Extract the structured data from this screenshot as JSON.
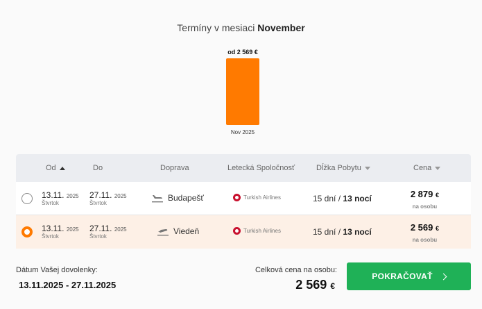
{
  "header": {
    "title_prefix": "Termíny v mesiaci",
    "title_month": "November"
  },
  "chart_data": {
    "type": "bar",
    "categories": [
      "Nov 2025"
    ],
    "values": [
      2569
    ],
    "value_labels": [
      "od 2 569 €"
    ],
    "bar_color": "#ff7a00",
    "title": "",
    "xlabel": "",
    "ylabel": ""
  },
  "table": {
    "columns": {
      "from": "Od",
      "to": "Do",
      "transport": "Doprava",
      "airline": "Letecká Spoločnosť",
      "stay": "Dĺžka Pobytu",
      "price": "Cena"
    },
    "rows": [
      {
        "selected": false,
        "from_date": "13.11.",
        "from_year": "2025",
        "from_day": "Štvrtok",
        "to_date": "27.11.",
        "to_year": "2025",
        "to_day": "Štvrtok",
        "transport_icon": "plane-landing-icon",
        "city": "Budapešť",
        "airline": "Turkish Airlines",
        "days": "15 dní",
        "nights": "13 nocí",
        "price": "2 879",
        "currency": "€",
        "per": "na osobu"
      },
      {
        "selected": true,
        "from_date": "13.11.",
        "from_year": "2025",
        "from_day": "Štvrtok",
        "to_date": "27.11.",
        "to_year": "2025",
        "to_day": "Štvrtok",
        "transport_icon": "plane-departure-icon",
        "city": "Viedeň",
        "airline": "Turkish Airlines",
        "days": "15 dní",
        "nights": "13 nocí",
        "price": "2 569",
        "currency": "€",
        "per": "na osobu"
      }
    ]
  },
  "summary": {
    "label": "Dátum Vašej dovolenky:",
    "dates": "13.11.2025 - 27.11.2025",
    "total_label": "Celková cena na osobu:",
    "total_price": "2 569",
    "currency": "€",
    "continue_label": "POKRAČOVAŤ"
  },
  "colors": {
    "accent": "#ff7a00",
    "continue": "#1fb157",
    "selected_row": "#fdf0e6"
  }
}
